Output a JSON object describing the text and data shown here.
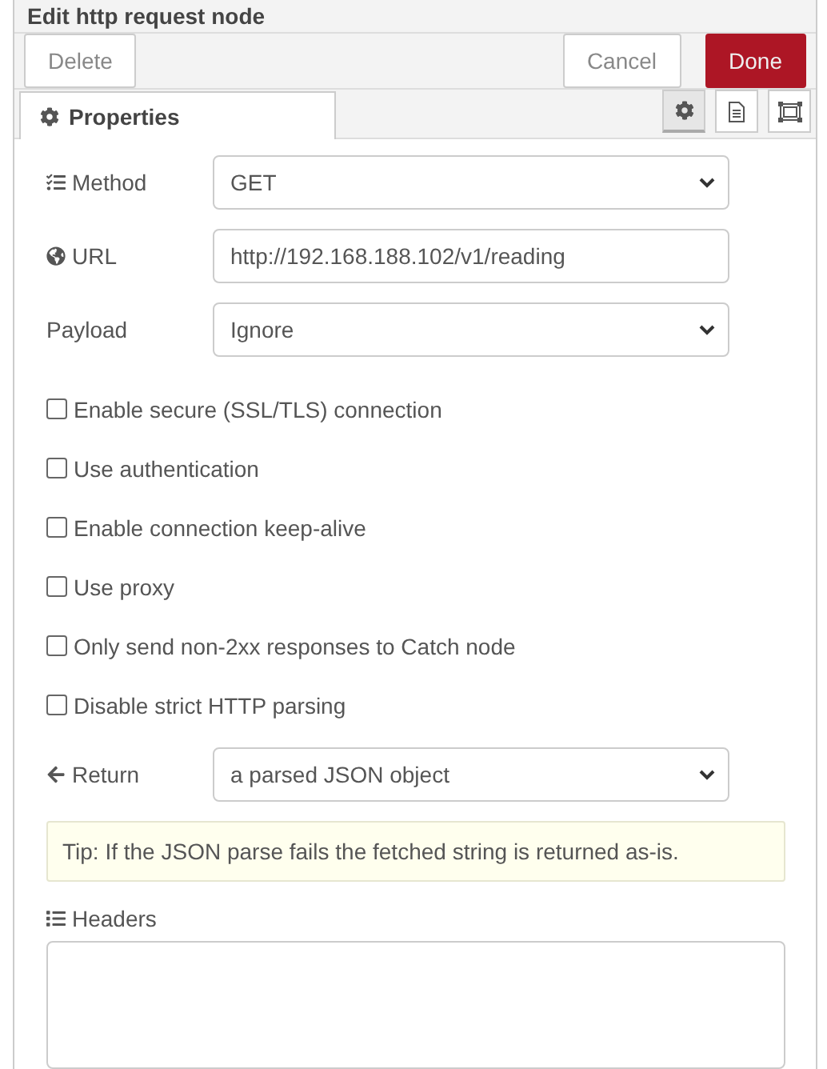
{
  "window": {
    "title": "Edit http request node"
  },
  "buttons": [
    {
      "label": "Delete",
      "kind": "plain"
    },
    {
      "label": "Cancel",
      "kind": "plain"
    },
    {
      "label": "Done",
      "kind": "primary"
    }
  ],
  "tabs": [
    {
      "label": "Properties",
      "selected": true
    }
  ],
  "tab_tools": [
    {
      "kind": "gear",
      "selected": true
    },
    {
      "kind": "document",
      "selected": false
    },
    {
      "kind": "frame",
      "selected": false
    }
  ],
  "fields": [
    {
      "label": "Method",
      "kind": "select",
      "value": "GET"
    },
    {
      "label": "URL",
      "kind": "input",
      "value": "http://192.168.188.102/v1/reading"
    },
    {
      "label": "Payload",
      "kind": "select",
      "value": "Ignore"
    }
  ],
  "checkboxes": [
    {
      "label": "Enable secure (SSL/TLS) connection",
      "checked": false
    },
    {
      "label": "Use authentication",
      "checked": false
    },
    {
      "label": "Enable connection keep-alive",
      "checked": false
    },
    {
      "label": "Use proxy",
      "checked": false
    },
    {
      "label": "Only send non-2xx responses to Catch node",
      "checked": false
    },
    {
      "label": "Disable strict HTTP parsing",
      "checked": false
    }
  ],
  "return": {
    "label": "Return",
    "kind": "select",
    "value": "a parsed JSON object"
  },
  "tip": "Tip: If the JSON parse fails the fetched string is returned as-is.",
  "headers": {
    "label": "Headers"
  }
}
